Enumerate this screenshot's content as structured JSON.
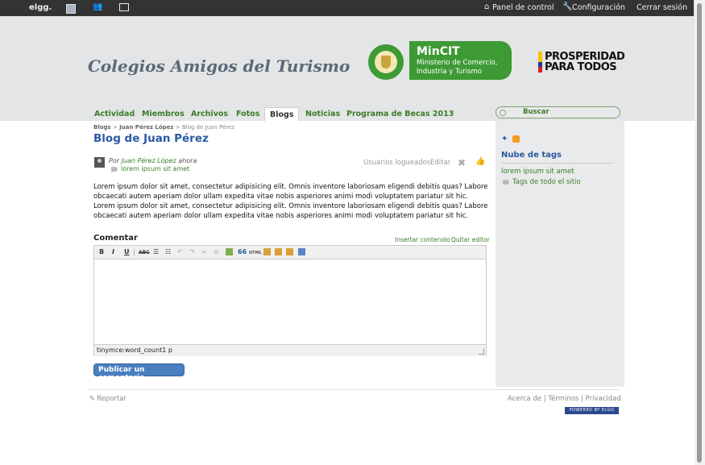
{
  "topbar": {
    "logo": "elgg.",
    "panel": "Panel de control",
    "config": "Configuración",
    "logout": "Cerrar sesión"
  },
  "header": {
    "site_title": "Colegios Amigos del Turismo",
    "mincit": {
      "title": "MinCIT",
      "line2": "Ministerio de Comercio,",
      "line3": "Industria y Turismo"
    },
    "prosperidad": {
      "line1": "PROSPERIDAD",
      "line2": "PARA TODOS"
    }
  },
  "tabs": [
    {
      "label": "Actividad"
    },
    {
      "label": "Miembros"
    },
    {
      "label": "Archivos"
    },
    {
      "label": "Fotos"
    },
    {
      "label": "Blogs",
      "active": true
    },
    {
      "label": "Noticias"
    },
    {
      "label": "Programa de Becas 2013"
    }
  ],
  "search": {
    "label": "Buscar"
  },
  "breadcrumb": {
    "part1": "Blogs",
    "sep": ">",
    "part2": "Juan Pérez López",
    "part3": "Blog de Juan Pérez"
  },
  "post": {
    "title": "Blog de Juan Pérez",
    "by_prefix": "Por",
    "author": "Juan Pérez López",
    "time": "ahora",
    "tag": "lorem ipsum sit amet",
    "access": "Usuarios logueados",
    "edit": "Editar",
    "body": "Lorem ipsum dolor sit amet, consectetur adipisicing elit. Omnis inventore laboriosam eligendi debitis quas? Labore obcaecati autem aperiam dolor ullam expedita vitae nobis asperiores animi modi voluptatem pariatur sit hic. Lorem ipsum dolor sit amet, consectetur adipisicing elit. Omnis inventore laboriosam eligendi debitis quas? Labore obcaecati autem aperiam dolor ullam expedita vitae nobis asperiores animi modi voluptatem pariatur sit hic."
  },
  "comment": {
    "heading": "Comentar",
    "insert": "Insertar contenido",
    "remove_editor": "Quitar editor",
    "status": "tinymce:word_count1 p",
    "submit": "Publicar un comentario"
  },
  "toolbar": {
    "bold": "B",
    "italic": "I",
    "underline": "U",
    "strike": "ABC",
    "quote": "66",
    "html": "HTML"
  },
  "sidebar": {
    "tags_title": "Nube de tags",
    "tag": "lorem ipsum sit amet",
    "all_tags": "Tags de todo el sitio"
  },
  "footer": {
    "report": "Reportar",
    "about": "Acerca de",
    "terms": "Términos",
    "privacy": "Privacidad",
    "sep": "|",
    "powered": "POWERED BY ELGG"
  }
}
